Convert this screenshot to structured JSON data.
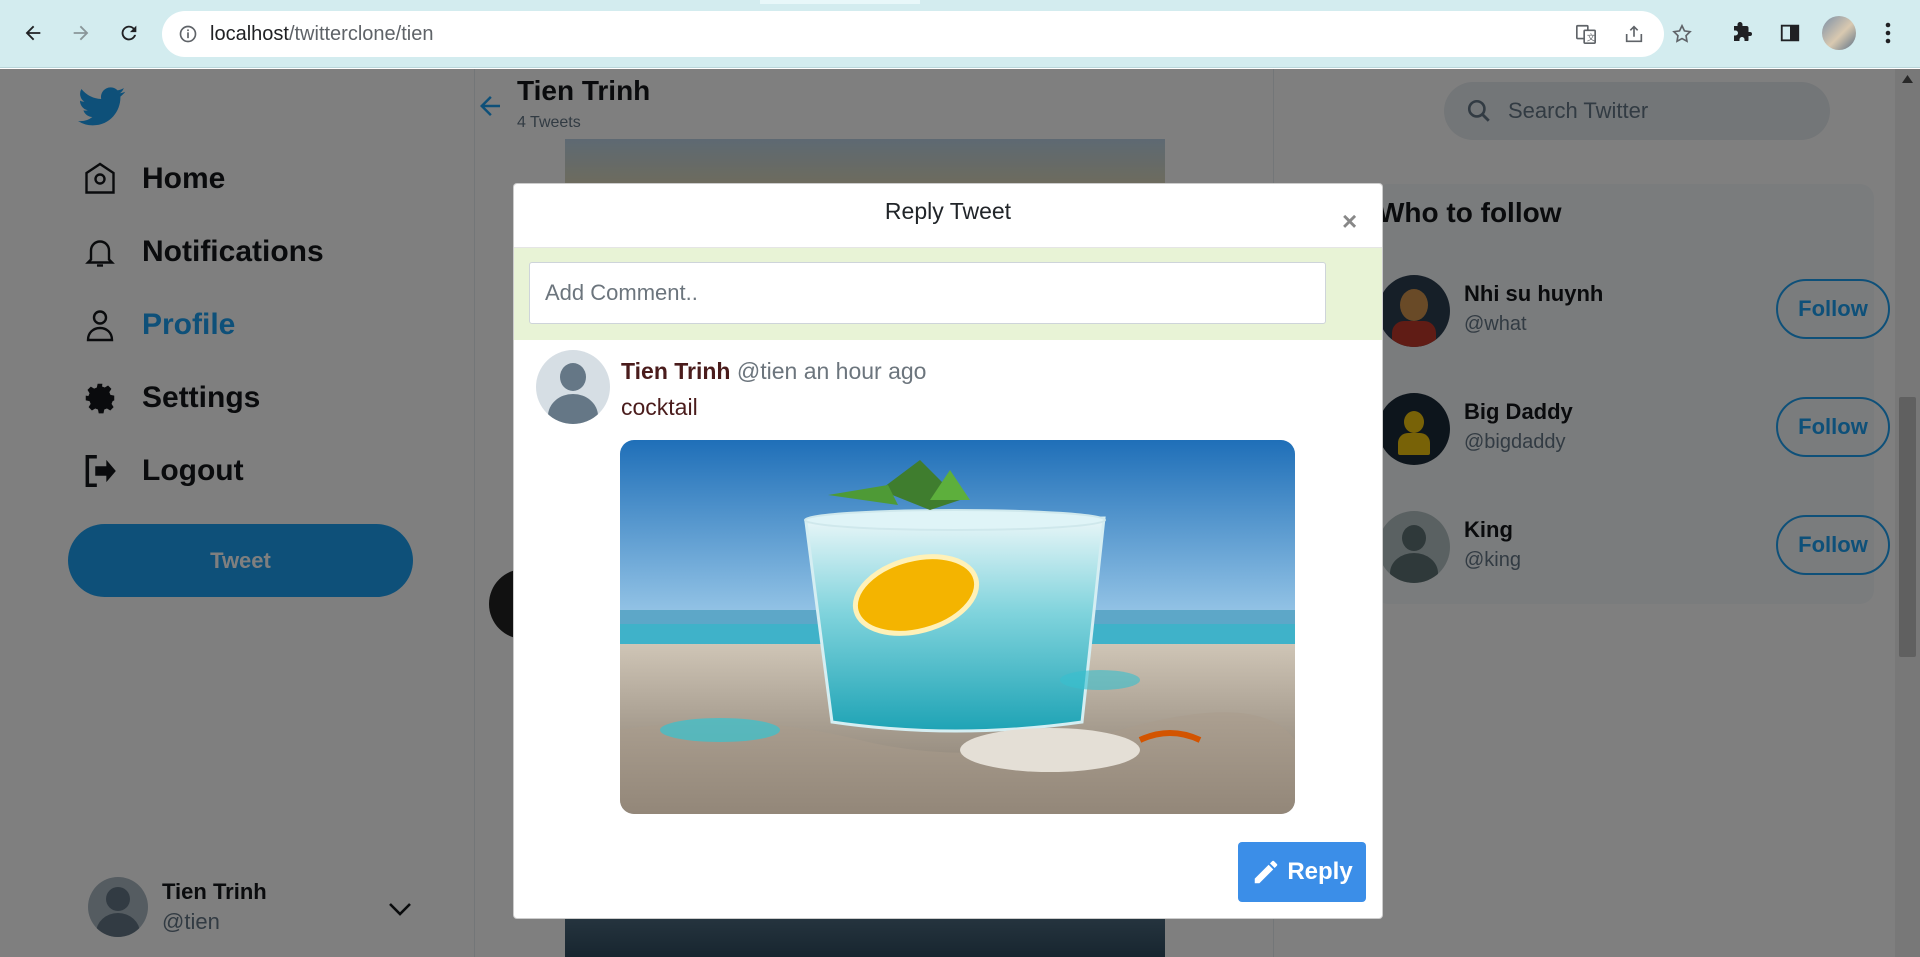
{
  "browser": {
    "url_host": "localhost",
    "url_path": "/twitterclone/tien"
  },
  "sidebar": {
    "items": [
      {
        "label": "Home",
        "icon": "home-icon"
      },
      {
        "label": "Notifications",
        "icon": "bell-icon"
      },
      {
        "label": "Profile",
        "icon": "user-icon",
        "active": true
      },
      {
        "label": "Settings",
        "icon": "gear-icon"
      },
      {
        "label": "Logout",
        "icon": "logout-icon"
      }
    ],
    "tweet_button": "Tweet",
    "current_user": {
      "name": "Tien Trinh",
      "handle": "@tien"
    }
  },
  "profile_header": {
    "name": "Tien Trinh",
    "tweet_count": "4 Tweets"
  },
  "right_panel": {
    "search_placeholder": "Search Twitter",
    "who_to_follow_title": "Who to follow",
    "suggestions": [
      {
        "name": "Nhi su huynh",
        "handle": "@what",
        "button": "Follow"
      },
      {
        "name": "Big Daddy",
        "handle": "@bigdaddy",
        "button": "Follow"
      },
      {
        "name": "King",
        "handle": "@king",
        "button": "Follow"
      }
    ]
  },
  "modal": {
    "title": "Reply Tweet",
    "close": "×",
    "comment_placeholder": "Add Comment..",
    "tweet": {
      "author": "Tien Trinh",
      "handle": "@tien",
      "time": "an hour ago",
      "text": "cocktail"
    },
    "reply_button": "Reply"
  },
  "colors": {
    "brand": "#1da1f2",
    "reply_button": "#3b8ee8",
    "comment_bar": "#e8f3d6"
  }
}
